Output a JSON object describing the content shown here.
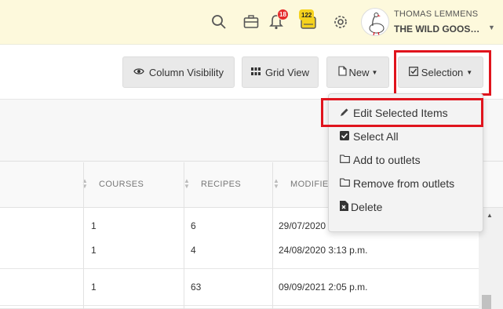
{
  "header": {
    "user_name": "THOMAS LEMMENS",
    "org_name": "THE WILD GOOS…",
    "notif_count": "18",
    "messages_count": "122"
  },
  "toolbar": {
    "column_visibility": "Column Visibility",
    "grid_view": "Grid View",
    "new": "New",
    "selection": "Selection"
  },
  "dropdown": {
    "items": [
      "Edit Selected Items",
      "Select All",
      "Add to outlets",
      "Remove from outlets",
      "Delete"
    ]
  },
  "table": {
    "headers": [
      "COURSES",
      "RECIPES",
      "MODIFIED"
    ],
    "rows": [
      {
        "courses": "1",
        "recipes": "6",
        "modified": "29/07/2020"
      },
      {
        "courses": "1",
        "recipes": "4",
        "modified": "24/08/2020 3:13 p.m."
      },
      {
        "courses": "1",
        "recipes": "63",
        "modified": "09/09/2021 2:05 p.m."
      }
    ]
  },
  "colors": {
    "highlight": "#e0141d",
    "header_bg": "#fdf9dc"
  }
}
